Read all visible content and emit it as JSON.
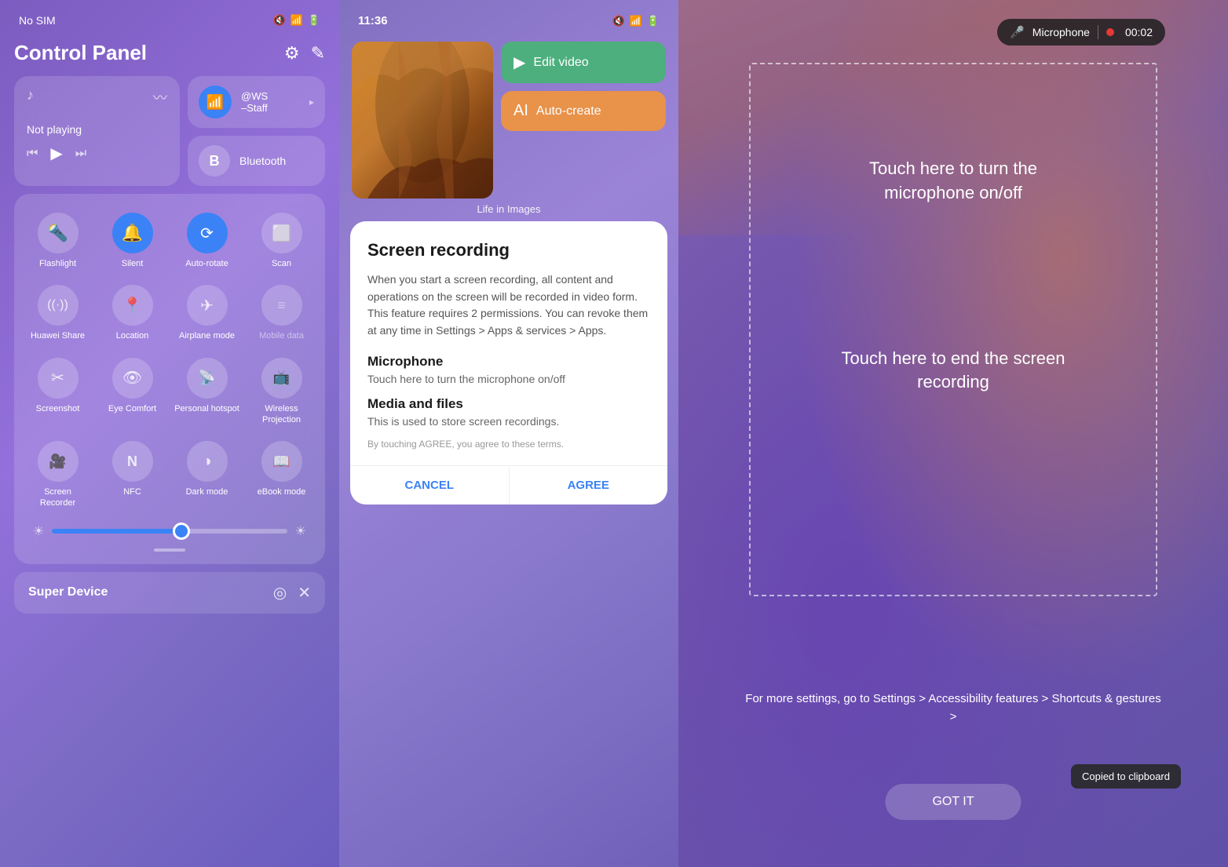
{
  "panel1": {
    "status": {
      "no_sim": "No SIM",
      "icons": "🔇📶🔋"
    },
    "title": "Control Panel",
    "music": {
      "not_playing": "Not playing"
    },
    "wifi": {
      "ssid": "@WS",
      "ssid2": "–Staff"
    },
    "bluetooth": {
      "label": "Bluetooth"
    },
    "toggles": [
      {
        "id": "flashlight",
        "label": "Flashlight",
        "icon": "🔦",
        "active": false
      },
      {
        "id": "silent",
        "label": "Silent",
        "icon": "🔔",
        "active": true
      },
      {
        "id": "autorotate",
        "label": "Auto-rotate",
        "icon": "🔄",
        "active": true
      },
      {
        "id": "scan",
        "label": "Scan",
        "icon": "⊡",
        "active": false
      },
      {
        "id": "huawei-share",
        "label": "Huawei Share",
        "icon": "((·))",
        "active": false
      },
      {
        "id": "location",
        "label": "Location",
        "icon": "📍",
        "active": false
      },
      {
        "id": "airplane",
        "label": "Airplane mode",
        "icon": "✈",
        "active": false
      },
      {
        "id": "mobile-data",
        "label": "Mobile data",
        "icon": "≡",
        "active": false,
        "muted": true
      },
      {
        "id": "screenshot",
        "label": "Screenshot",
        "icon": "✂",
        "active": false
      },
      {
        "id": "eye-comfort",
        "label": "Eye Comfort",
        "icon": "👁",
        "active": false
      },
      {
        "id": "hotspot",
        "label": "Personal hotspot",
        "icon": "📡",
        "active": false
      },
      {
        "id": "wireless-proj",
        "label": "Wireless Projection",
        "icon": "⊡",
        "active": false
      },
      {
        "id": "screen-recorder",
        "label": "Screen Recorder",
        "icon": "🎥",
        "active": false
      },
      {
        "id": "nfc",
        "label": "NFC",
        "icon": "N",
        "active": false
      },
      {
        "id": "dark-mode",
        "label": "Dark mode",
        "icon": "◑",
        "active": false
      },
      {
        "id": "ebook",
        "label": "eBook mode",
        "icon": "📖",
        "active": false
      }
    ],
    "super_device": "Super Device",
    "gear_icon": "⚙",
    "edit_icon": "✎",
    "settings_icon": "⚙",
    "target_icon": "◎",
    "close_icon": "✕"
  },
  "panel2": {
    "status": {
      "time": "11:36",
      "icons": "🔇📶🔋"
    },
    "album": {
      "title": "Life in Images"
    },
    "actions": {
      "edit_video": "Edit video",
      "auto_create": "Auto-create"
    },
    "dialog": {
      "title": "Screen recording",
      "description": "When you start a screen recording, all content and operations on the screen will be recorded in video form. This feature requires 2 permissions. You can revoke them at any time in Settings > Apps & services > Apps.",
      "perm1_title": "Microphone",
      "perm1_desc": "Touch here to turn the microphone on/off",
      "perm2_title": "Media and files",
      "perm2_desc": "This is used to store screen recordings.",
      "terms": "By touching AGREE, you agree to these terms.",
      "cancel": "CANCEL",
      "agree": "AGREE"
    }
  },
  "panel3": {
    "recording": {
      "mic_label": "Microphone",
      "time": "00:02"
    },
    "touch1": "Touch here to turn the\nmicrophone on/off",
    "touch2": "Touch here to end the screen\nrecording",
    "settings_hint": "For more settings, go to Settings > Accessibility features > Shortcuts & gestures >",
    "got_it": "GOT IT",
    "clipboard_toast": "Copied to clipboard"
  }
}
